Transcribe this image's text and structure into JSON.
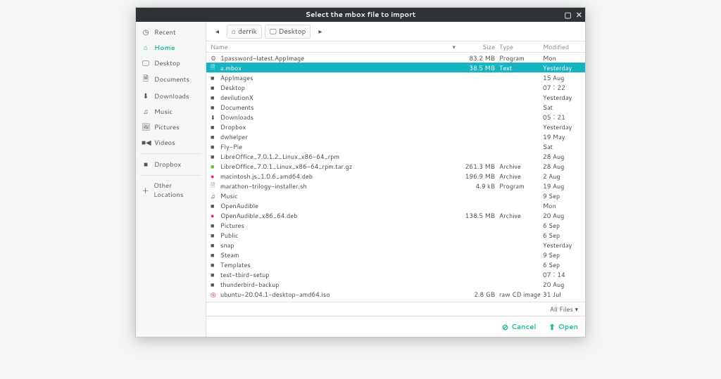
{
  "title": "Select the mbox file to import",
  "wincontrols": {
    "max": "▢",
    "close": "✕"
  },
  "sidebar": {
    "items": [
      {
        "icon": "◷",
        "label": "Recent"
      },
      {
        "icon": "⌂",
        "label": "Home",
        "active": true
      },
      {
        "icon": "🖵",
        "label": "Desktop"
      },
      {
        "icon": "🗎",
        "label": "Documents"
      },
      {
        "icon": "⬇",
        "label": "Downloads"
      },
      {
        "icon": "♫",
        "label": "Music"
      },
      {
        "icon": "🖼",
        "label": "Pictures"
      },
      {
        "icon": "■◀",
        "label": "Videos"
      }
    ],
    "extra": [
      {
        "icon": "■",
        "label": "Dropbox"
      }
    ],
    "other": {
      "icon": "＋",
      "label": "Other Locations"
    }
  },
  "pathbar": {
    "back": "◂",
    "segments": [
      {
        "icon": "⌂",
        "label": "derrik"
      },
      {
        "icon": "🖵",
        "label": "Desktop"
      }
    ],
    "fwd": "▸"
  },
  "columns": {
    "name": "Name",
    "sort": "▾",
    "size": "Size",
    "type": "Type",
    "modified": "Modified"
  },
  "files": [
    {
      "icon": "gear",
      "name": "1password-latest.AppImage",
      "size": "83.2 MB",
      "type": "Program",
      "mod": "Mon"
    },
    {
      "icon": "text",
      "name": "a.mbox",
      "size": "38.5 MB",
      "type": "Text",
      "mod": "Yesterday",
      "selected": true
    },
    {
      "icon": "folder",
      "name": "AppImages",
      "size": "",
      "type": "",
      "mod": "15 Aug"
    },
    {
      "icon": "folder",
      "name": "Desktop",
      "size": "",
      "type": "",
      "mod": "07︰22"
    },
    {
      "icon": "folder",
      "name": "devilutionX",
      "size": "",
      "type": "",
      "mod": "Yesterday"
    },
    {
      "icon": "folder",
      "name": "Documents",
      "size": "",
      "type": "",
      "mod": "Sat"
    },
    {
      "icon": "down",
      "name": "Downloads",
      "size": "",
      "type": "",
      "mod": "05︰21"
    },
    {
      "icon": "folder",
      "name": "Dropbox",
      "size": "",
      "type": "",
      "mod": "Yesterday"
    },
    {
      "icon": "folder",
      "name": "dwhelper",
      "size": "",
      "type": "",
      "mod": "19 May"
    },
    {
      "icon": "folder",
      "name": "Fly-Pie",
      "size": "",
      "type": "",
      "mod": "Sat"
    },
    {
      "icon": "folder",
      "name": "LibreOffice_7.0.1.2_Linux_x86-64_rpm",
      "size": "",
      "type": "",
      "mod": "28 Aug"
    },
    {
      "icon": "green",
      "name": "LibreOffice_7.0.1_Linux_x86-64_rpm.tar.gz",
      "size": "261.3 MB",
      "type": "Archive",
      "mod": "28 Aug"
    },
    {
      "icon": "pink",
      "name": "macintosh.js_1.0.6_amd64.deb",
      "size": "196.9 MB",
      "type": "Archive",
      "mod": "2 Aug"
    },
    {
      "icon": "file",
      "name": "marathon-trilogy-installer.sh",
      "size": "4.9 kB",
      "type": "Program",
      "mod": "19 Aug"
    },
    {
      "icon": "music",
      "name": "Music",
      "size": "",
      "type": "",
      "mod": "9 Sep"
    },
    {
      "icon": "folder",
      "name": "OpenAudible",
      "size": "",
      "type": "",
      "mod": "Mon"
    },
    {
      "icon": "pink",
      "name": "OpenAudible_x86_64.deb",
      "size": "138.5 MB",
      "type": "Archive",
      "mod": "20 Aug"
    },
    {
      "icon": "folder",
      "name": "Pictures",
      "size": "",
      "type": "",
      "mod": "6 Sep"
    },
    {
      "icon": "folder",
      "name": "Public",
      "size": "",
      "type": "",
      "mod": "6 Sep"
    },
    {
      "icon": "folder",
      "name": "snap",
      "size": "",
      "type": "",
      "mod": "Yesterday"
    },
    {
      "icon": "folder",
      "name": "Steam",
      "size": "",
      "type": "",
      "mod": "9 Sep"
    },
    {
      "icon": "folder",
      "name": "Templates",
      "size": "",
      "type": "",
      "mod": "6 Sep"
    },
    {
      "icon": "folder",
      "name": "test-tbird-setup",
      "size": "",
      "type": "",
      "mod": "07︰14"
    },
    {
      "icon": "folder",
      "name": "thunderbird-backup",
      "size": "",
      "type": "",
      "mod": "20 Aug"
    },
    {
      "icon": "disc",
      "name": "ubuntu-20.04.1-desktop-amd64.iso",
      "size": "2.8 GB",
      "type": "raw CD image",
      "mod": "31 Jul"
    }
  ],
  "filter": {
    "label": "All Files",
    "caret": "▾"
  },
  "actions": {
    "cancel_icon": "⊘",
    "cancel": "Cancel",
    "open_icon": "⬆",
    "open": "Open"
  }
}
